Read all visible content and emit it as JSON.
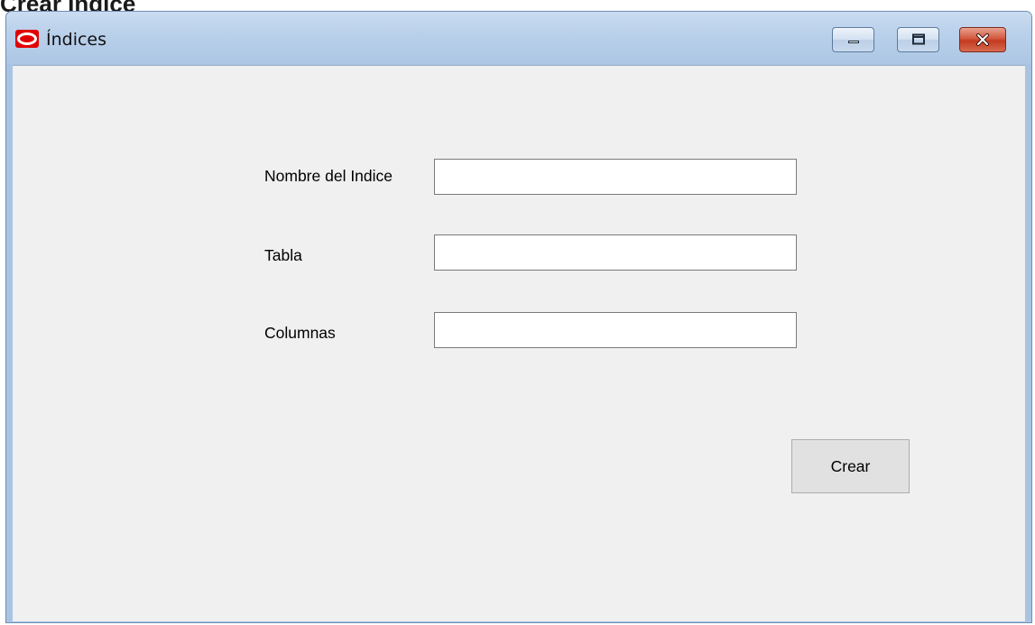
{
  "page": {
    "heading": "Crear Indice"
  },
  "window": {
    "title": "Índices",
    "app_icon": "oracle-logo-icon",
    "controls": {
      "minimize_icon": "minimize-icon",
      "maximize_icon": "maximize-icon",
      "close_icon": "close-icon"
    }
  },
  "form": {
    "fields": [
      {
        "label": "Nombre del Indice",
        "value": "",
        "placeholder": ""
      },
      {
        "label": "Tabla",
        "value": "",
        "placeholder": ""
      },
      {
        "label": "Columnas",
        "value": "",
        "placeholder": ""
      }
    ],
    "submit_label": "Crear"
  },
  "colors": {
    "title_bar": "#b9d0ea",
    "client_background": "#f0f0f0",
    "close_button": "#c33a1f",
    "app_icon_red": "#e10000"
  }
}
